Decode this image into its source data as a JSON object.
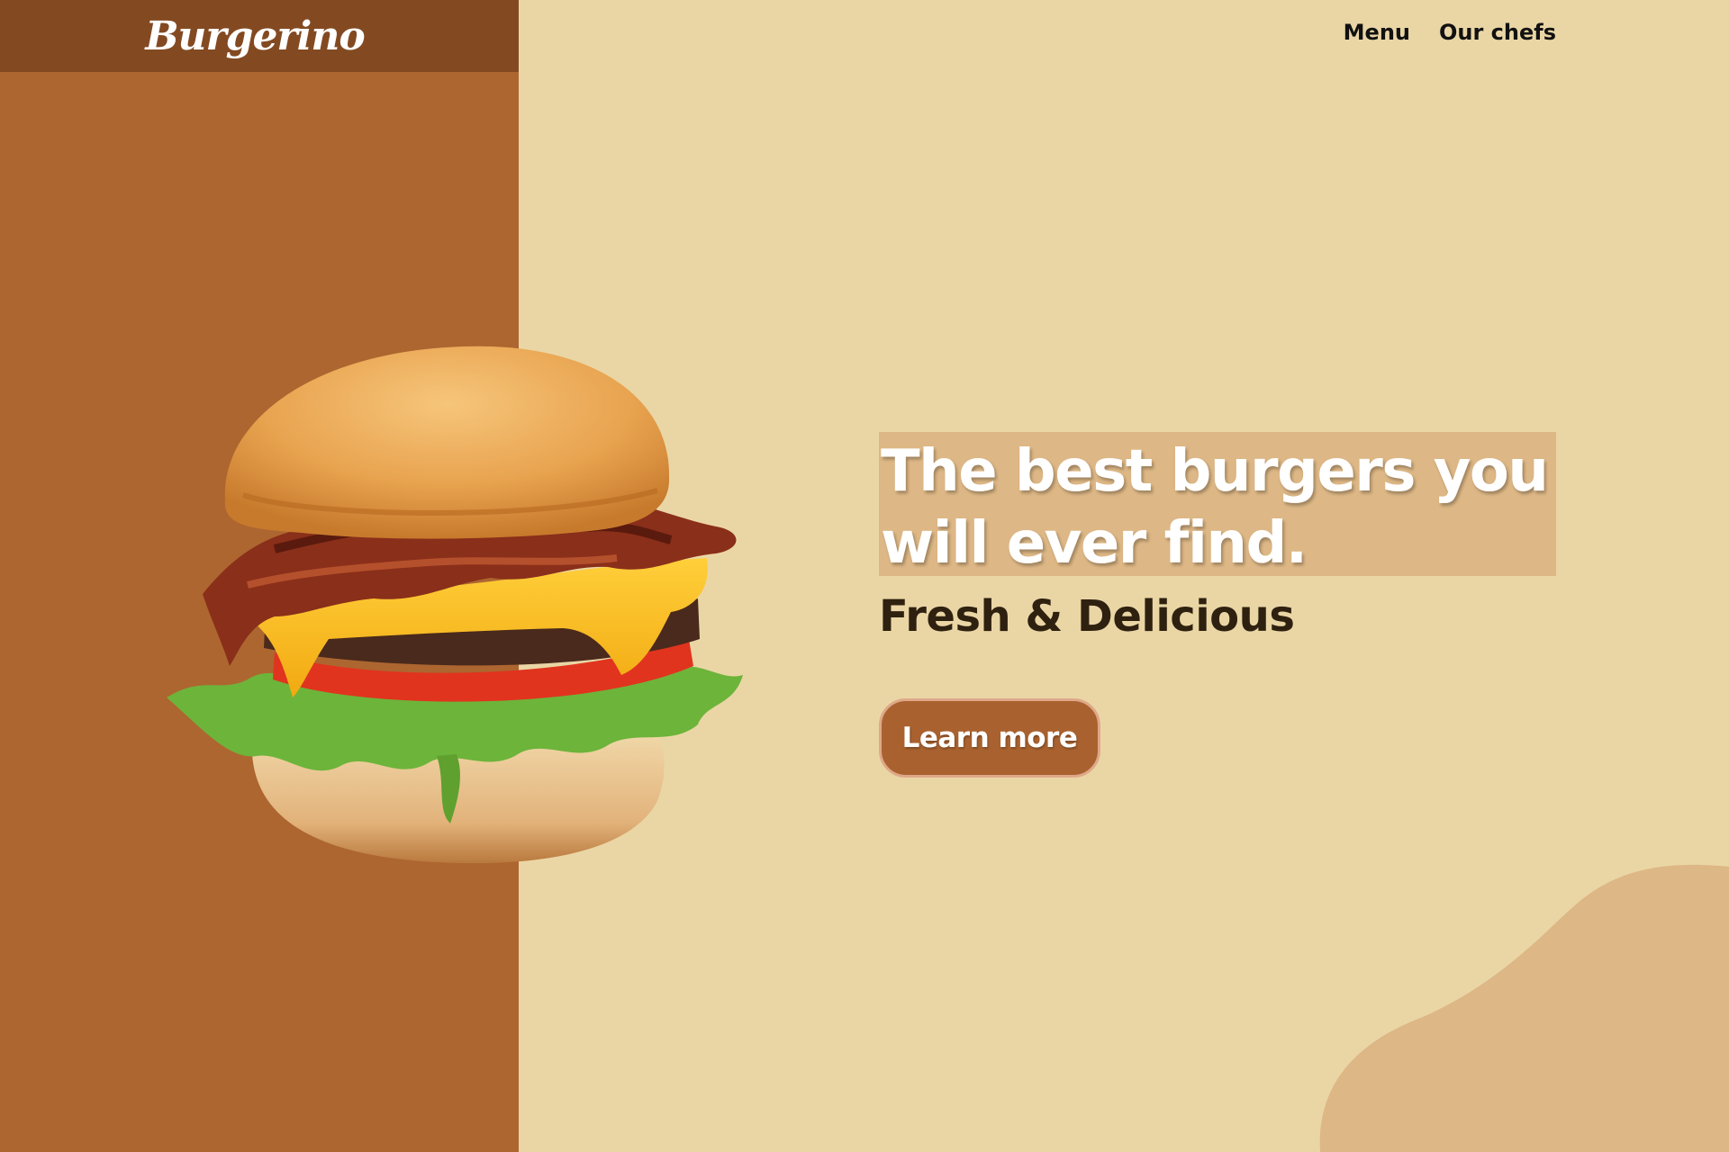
{
  "brand": {
    "logo_text": "Burgerino"
  },
  "nav": {
    "items": [
      {
        "label": "Menu"
      },
      {
        "label": "Our chefs"
      }
    ]
  },
  "hero": {
    "headline": "The best burgers you will ever find.",
    "subheadline": "Fresh & Delicious",
    "cta_label": "Learn more",
    "image": "burger-photo"
  },
  "colors": {
    "left_panel": "#ad6630",
    "logo_bar": "#834a22",
    "background": "#ead6a5",
    "headline_box": "#ddb785",
    "blob": "#ddb785",
    "cta": "#a9622f",
    "cta_border": "#dfa889",
    "subheadline": "#2f2110"
  }
}
